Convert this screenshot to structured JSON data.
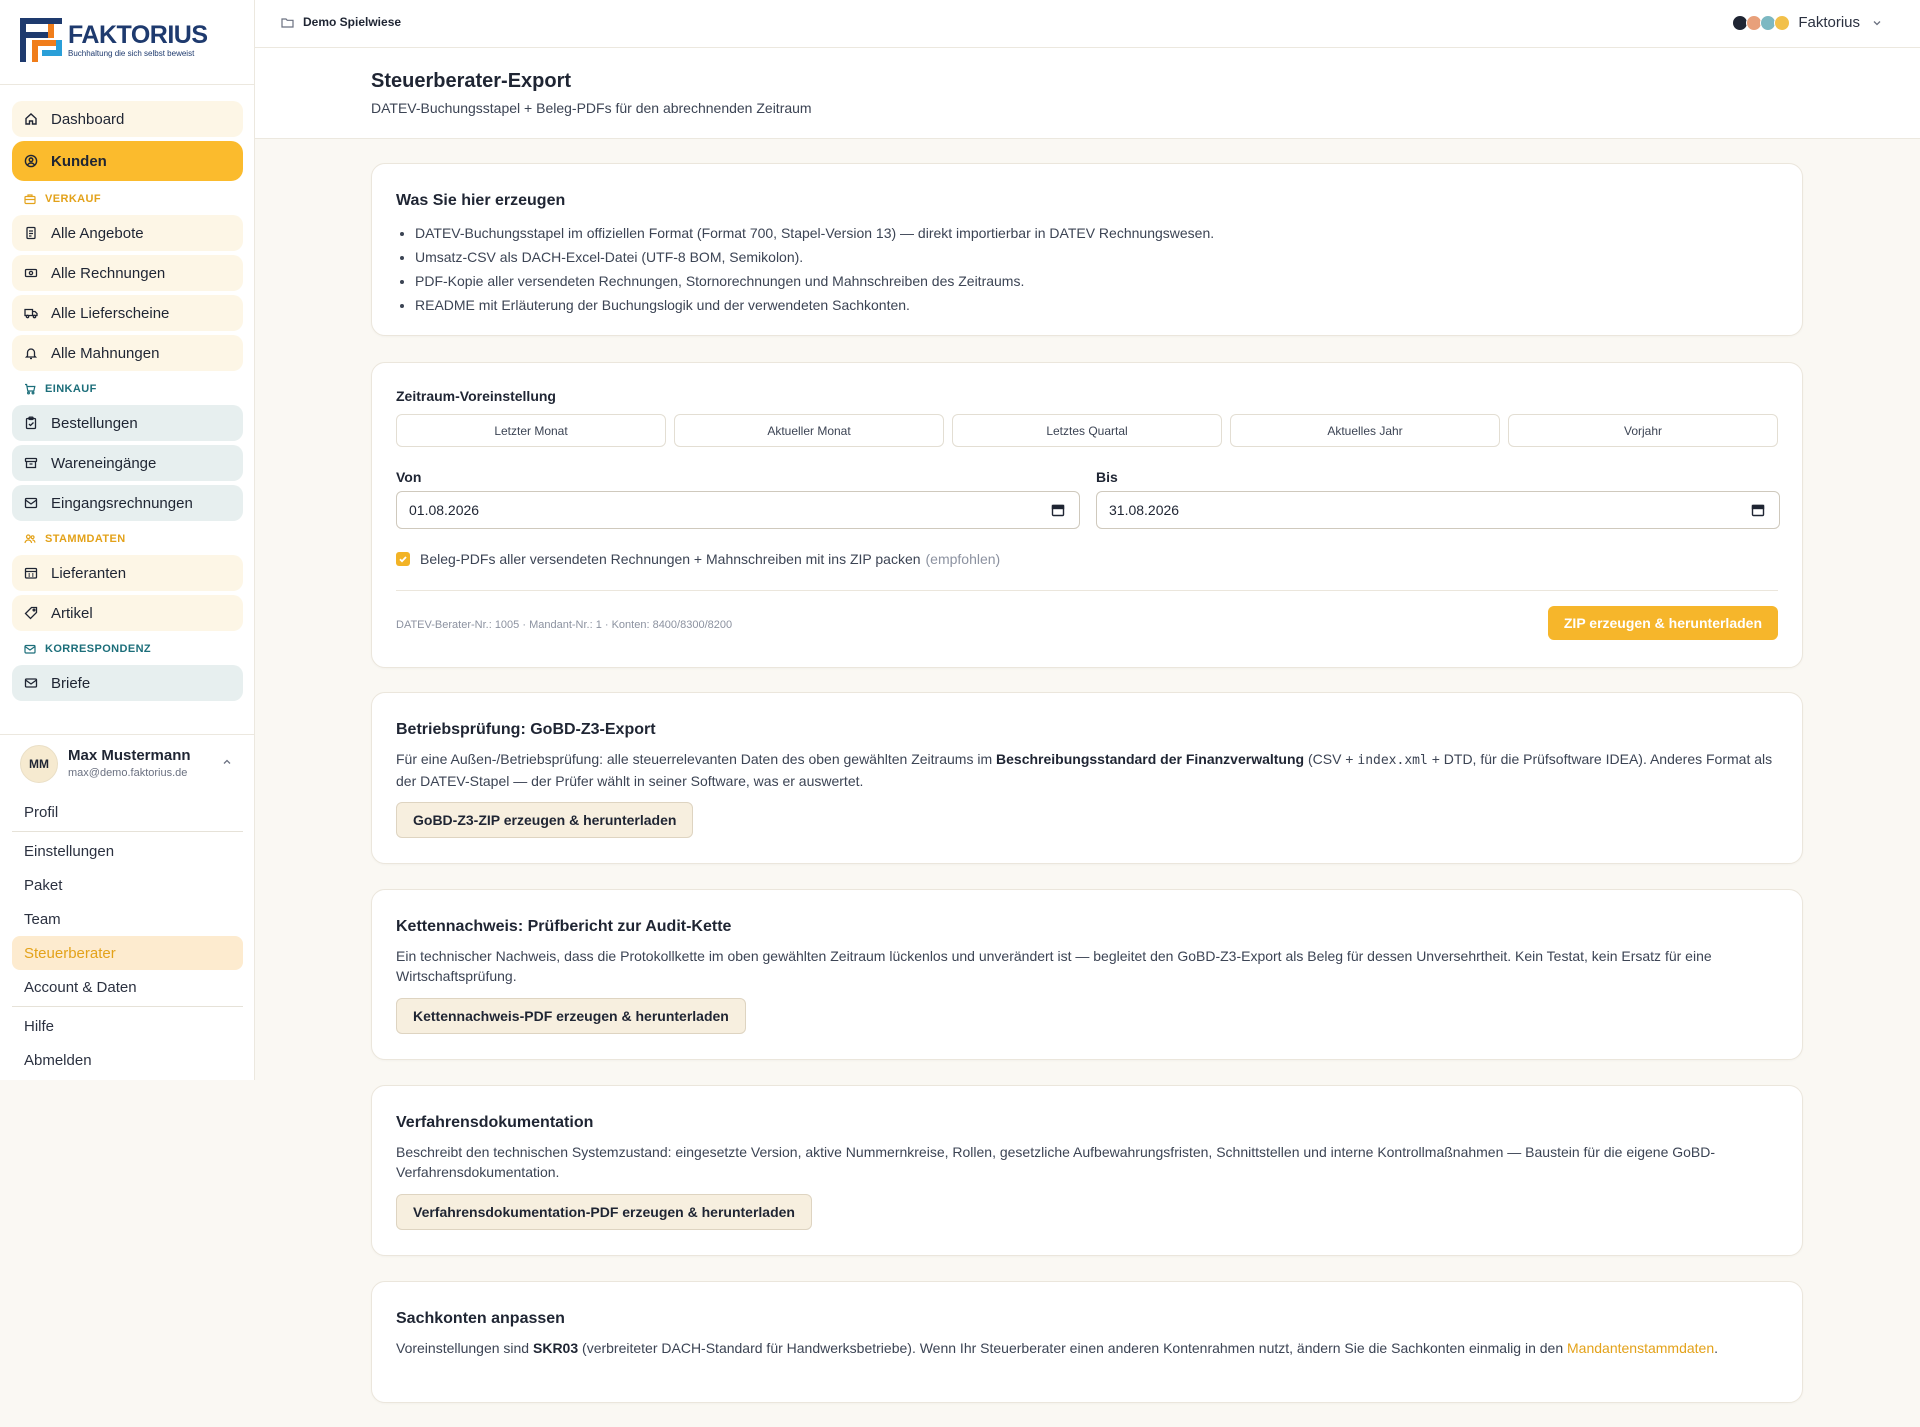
{
  "brand": {
    "name": "FAKTORIUS",
    "tagline": "Buchhaltung die sich selbst beweist",
    "colors": {
      "accent": "#fbbb2d",
      "navy": "#1e3a6e",
      "teal": "#1c6e7a",
      "orange": "#f07d1a"
    }
  },
  "sidebar": {
    "top_items": [
      {
        "label": "Dashboard",
        "icon": "home-icon"
      },
      {
        "label": "Kunden",
        "icon": "user-circle-icon",
        "active": true
      }
    ],
    "sections": [
      {
        "label": "VERKAUF",
        "icon": "briefcase-icon",
        "items": [
          {
            "label": "Alle Angebote",
            "icon": "document-icon"
          },
          {
            "label": "Alle Rechnungen",
            "icon": "banknote-icon"
          },
          {
            "label": "Alle Lieferscheine",
            "icon": "truck-icon"
          },
          {
            "label": "Alle Mahnungen",
            "icon": "bell-icon"
          }
        ]
      },
      {
        "label": "EINKAUF",
        "icon": "cart-icon",
        "items": [
          {
            "label": "Bestellungen",
            "icon": "clipboard-icon"
          },
          {
            "label": "Wareneingänge",
            "icon": "archive-box-icon"
          },
          {
            "label": "Eingangsrechnungen",
            "icon": "inbox-icon"
          }
        ]
      },
      {
        "label": "STAMMDATEN",
        "icon": "users-icon",
        "items": [
          {
            "label": "Lieferanten",
            "icon": "building-icon"
          },
          {
            "label": "Artikel",
            "icon": "tag-icon"
          }
        ]
      },
      {
        "label": "KORRESPONDENZ",
        "icon": "mail-icon",
        "items": [
          {
            "label": "Briefe",
            "icon": "envelope-icon"
          }
        ]
      }
    ],
    "user": {
      "initials": "MM",
      "name": "Max Mustermann",
      "email": "max@demo.faktorius.de",
      "menu": [
        "Profil",
        "Einstellungen",
        "Paket",
        "Team",
        "Steuerberater",
        "Account & Daten",
        "Hilfe",
        "Abmelden"
      ],
      "active_menu": "Steuerberater"
    }
  },
  "topbar": {
    "breadcrumb": "Demo Spielwiese",
    "tenant": "Faktorius"
  },
  "page": {
    "title": "Steuerberater-Export",
    "subtitle": "DATEV-Buchungsstapel + Beleg-PDFs für den abrechnenden Zeitraum"
  },
  "info_card": {
    "title": "Was Sie hier erzeugen",
    "bullets": [
      "DATEV-Buchungsstapel im offiziellen Format (Format 700, Stapel-Version 13) — direkt importierbar in DATEV Rechnungswesen.",
      "Umsatz-CSV als DACH-Excel-Datei (UTF-8 BOM, Semikolon).",
      "PDF-Kopie aller versendeten Rechnungen, Stornorechnungen und Mahnschreiben des Zeitraums.",
      "README mit Erläuterung der Buchungslogik und der verwendeten Sachkonten."
    ]
  },
  "export_card": {
    "preset_label": "Zeitraum-Voreinstellung",
    "presets": [
      "Letzter Monat",
      "Aktueller Monat",
      "Letztes Quartal",
      "Aktuelles Jahr",
      "Vorjahr"
    ],
    "from_label": "Von",
    "from_value": "01.08.2026",
    "to_label": "Bis",
    "to_value": "31.08.2026",
    "checkbox_label": "Beleg-PDFs aller versendeten Rechnungen + Mahnschreiben mit ins ZIP packen",
    "checkbox_hint": "(empfohlen)",
    "checkbox_checked": true,
    "footnote": "DATEV-Berater-Nr.: 1005 · Mandant-Nr.: 1 · Konten: 8400/8300/8200",
    "button": "ZIP erzeugen & herunterladen"
  },
  "gobd_card": {
    "title": "Betriebsprüfung: GoBD-Z3-Export",
    "text_1": "Für eine Außen-/Betriebsprüfung: alle steuerrelevanten Daten des oben gewählten Zeitraums im",
    "text_bold": "Beschreibungsstandard der Finanzverwaltung",
    "text_2": "(CSV +",
    "text_code": "index.xml",
    "text_3": "+ DTD, für die Prüfsoftware IDEA). Anderes Format als der DATEV-Stapel — der Prüfer wählt in seiner Software, was er auswertet.",
    "button": "GoBD-Z3-ZIP erzeugen & herunterladen"
  },
  "chain_card": {
    "title": "Kettennachweis: Prüfbericht zur Audit-Kette",
    "text": "Ein technischer Nachweis, dass die Protokollkette im oben gewählten Zeitraum lückenlos und unverändert ist — begleitet den GoBD-Z3-Export als Beleg für dessen Unversehrtheit. Kein Testat, kein Ersatz für eine Wirtschaftsprüfung.",
    "button": "Kettennachweis-PDF erzeugen & herunterladen"
  },
  "proc_card": {
    "title": "Verfahrensdokumentation",
    "text": "Beschreibt den technischen Systemzustand: eingesetzte Version, aktive Nummernkreise, Rollen, gesetzliche Aufbewahrungsfristen, Schnittstellen und interne Kontrollmaßnahmen — Baustein für die eigene GoBD-Verfahrensdokumentation.",
    "button": "Verfahrensdokumentation-PDF erzeugen & herunterladen"
  },
  "accounts_card": {
    "title": "Sachkonten anpassen",
    "text_1": "Voreinstellungen sind",
    "text_bold": "SKR03",
    "text_2": "(verbreiteter DACH-Standard für Handwerksbetriebe). Wenn Ihr Steuerberater einen anderen Kontenrahmen nutzt, ändern Sie die Sachkonten einmalig in den",
    "link": "Mandantenstammdaten",
    "text_3": "."
  }
}
